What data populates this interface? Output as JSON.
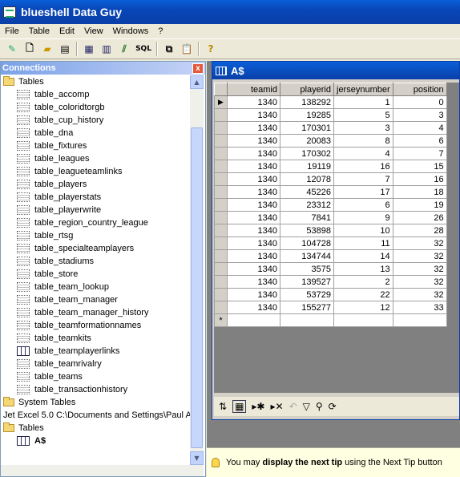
{
  "app": {
    "title": "blueshell Data Guy"
  },
  "menu": [
    "File",
    "Table",
    "Edit",
    "View",
    "Windows",
    "?"
  ],
  "toolbar": {
    "buttons": [
      "new-wizard-icon",
      "new-file-icon",
      "open-folder-icon",
      "properties-icon",
      "table-icon",
      "table-edit-icon",
      "chart-icon",
      "SQL",
      "copy-icon",
      "paste-icon",
      "help-icon"
    ],
    "sql_label": "SQL",
    "help_label": "?"
  },
  "connections": {
    "title": "Connections",
    "close_label": "x",
    "tree": [
      {
        "type": "folder",
        "label": "Tables",
        "indent": 0
      },
      {
        "type": "table",
        "label": "table_accomp",
        "indent": 1
      },
      {
        "type": "table",
        "label": "table_coloridtorgb",
        "indent": 1
      },
      {
        "type": "table",
        "label": "table_cup_history",
        "indent": 1
      },
      {
        "type": "table",
        "label": "table_dna",
        "indent": 1
      },
      {
        "type": "table",
        "label": "table_fixtures",
        "indent": 1
      },
      {
        "type": "table",
        "label": "table_leagues",
        "indent": 1
      },
      {
        "type": "table",
        "label": "table_leagueteamlinks",
        "indent": 1
      },
      {
        "type": "table",
        "label": "table_players",
        "indent": 1
      },
      {
        "type": "table",
        "label": "table_playerstats",
        "indent": 1
      },
      {
        "type": "table",
        "label": "table_playerwrite",
        "indent": 1
      },
      {
        "type": "table",
        "label": "table_region_country_league",
        "indent": 1
      },
      {
        "type": "table",
        "label": "table_rtsg",
        "indent": 1
      },
      {
        "type": "table",
        "label": "table_specialteamplayers",
        "indent": 1
      },
      {
        "type": "table",
        "label": "table_stadiums",
        "indent": 1
      },
      {
        "type": "table",
        "label": "table_store",
        "indent": 1
      },
      {
        "type": "table",
        "label": "table_team_lookup",
        "indent": 1
      },
      {
        "type": "table",
        "label": "table_team_manager",
        "indent": 1
      },
      {
        "type": "table",
        "label": "table_team_manager_history",
        "indent": 1
      },
      {
        "type": "table",
        "label": "table_teamformationnames",
        "indent": 1
      },
      {
        "type": "table",
        "label": "table_teamkits",
        "indent": 1
      },
      {
        "type": "table-solid",
        "label": "table_teamplayerlinks",
        "indent": 1
      },
      {
        "type": "table",
        "label": "table_teamrivalry",
        "indent": 1
      },
      {
        "type": "table",
        "label": "table_teams",
        "indent": 1
      },
      {
        "type": "table",
        "label": "table_transactionhistory",
        "indent": 1
      },
      {
        "type": "folder",
        "label": "System Tables",
        "indent": 0
      },
      {
        "type": "text",
        "label": "Jet Excel 5.0 C:\\Documents and Settings\\Paul A",
        "indent": 0
      },
      {
        "type": "folder",
        "label": "Tables",
        "indent": 0
      },
      {
        "type": "table-solid",
        "label": "A$",
        "indent": 1,
        "bold": true
      }
    ]
  },
  "grid": {
    "title": "A$",
    "columns": [
      "teamid",
      "playerid",
      "jerseynumber",
      "position"
    ],
    "rows": [
      [
        "1340",
        "138292",
        "1",
        "0"
      ],
      [
        "1340",
        "19285",
        "5",
        "3"
      ],
      [
        "1340",
        "170301",
        "3",
        "4"
      ],
      [
        "1340",
        "20083",
        "8",
        "6"
      ],
      [
        "1340",
        "170302",
        "4",
        "7"
      ],
      [
        "1340",
        "19119",
        "16",
        "15"
      ],
      [
        "1340",
        "12078",
        "7",
        "16"
      ],
      [
        "1340",
        "45226",
        "17",
        "18"
      ],
      [
        "1340",
        "23312",
        "6",
        "19"
      ],
      [
        "1340",
        "7841",
        "9",
        "26"
      ],
      [
        "1340",
        "53898",
        "10",
        "28"
      ],
      [
        "1340",
        "104728",
        "11",
        "32"
      ],
      [
        "1340",
        "134744",
        "14",
        "32"
      ],
      [
        "1340",
        "3575",
        "13",
        "32"
      ],
      [
        "1340",
        "139527",
        "2",
        "32"
      ],
      [
        "1340",
        "53729",
        "22",
        "32"
      ],
      [
        "1340",
        "155277",
        "12",
        "33"
      ]
    ],
    "current_row_marker": "▶",
    "new_row_marker": "*"
  },
  "tip": {
    "prefix": "You may ",
    "bold": "display the next tip",
    "suffix": " using the Next Tip button"
  }
}
